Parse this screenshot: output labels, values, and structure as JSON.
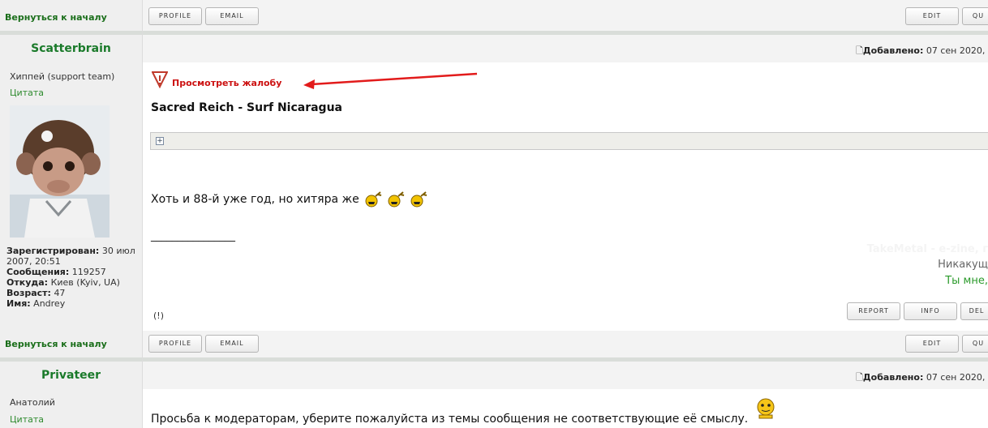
{
  "nav": {
    "back_label": "Вернуться к началу"
  },
  "buttons": {
    "profile": "PROFILE",
    "email": "EMAIL",
    "edit": "EDIT",
    "quote": "QU",
    "report": "REPORT",
    "info": "INFO",
    "delete": "DEL"
  },
  "post1": {
    "username": "Scatterbrain",
    "added_label": "Добавлено:",
    "added_date": "07 сен 2020,",
    "rank": "Хиппей (support team)",
    "quote_label": "Цитата",
    "report_link": "Просмотреть жалобу",
    "title": "Sacred Reich - Surf Nicaragua",
    "spoiler_toggle": "+",
    "text": "Хоть и 88-й уже год, но хитяра же",
    "signature_line": "________________",
    "sig1": "TakeMetal - e-zine, г",
    "sig2": "Никакущ",
    "sig3": "Ты мне,",
    "report_mark": "(!)",
    "registered_label": "Зарегистрирован:",
    "registered_value": "30 июл 2007, 20:51",
    "messages_label": "Сообщения:",
    "messages_value": "119257",
    "from_label": "Откуда:",
    "from_value": "Киев (Kyiv, UA)",
    "age_label": "Возраст:",
    "age_value": "47",
    "name_label": "Имя:",
    "name_value": "Andrey"
  },
  "post2": {
    "username": "Privateer",
    "added_label": "Добавлено:",
    "added_date": "07 сен 2020,",
    "rank": "Анатолий",
    "quote_label": "Цитата",
    "text": "Просьба к модераторам, уберите пожалуйста из темы сообщения не соответствующие её смыслу."
  },
  "colors": {
    "username": "#1a7a2a",
    "link_red": "#cc1111",
    "separator": "#d9ddd9"
  }
}
